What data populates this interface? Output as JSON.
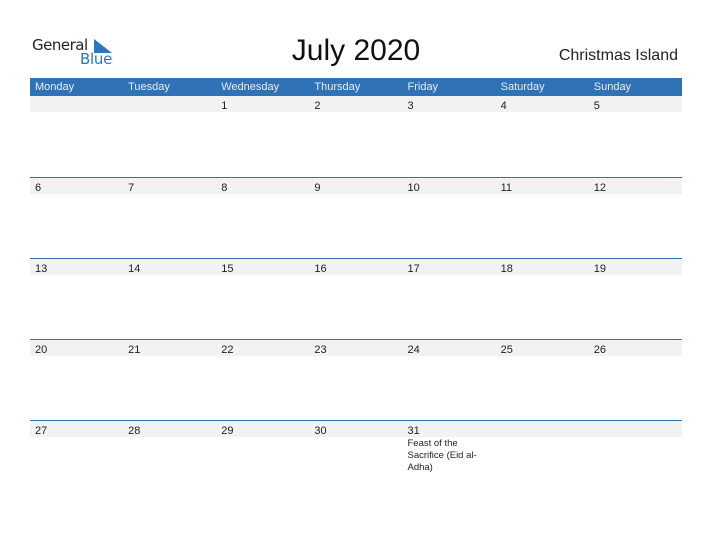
{
  "logo": {
    "general": "General",
    "blue": "Blue",
    "brand_color": "#2f75bd"
  },
  "title": "July 2020",
  "region": "Christmas Island",
  "header_color": "#2f72b5",
  "weekdays": [
    "Monday",
    "Tuesday",
    "Wednesday",
    "Thursday",
    "Friday",
    "Saturday",
    "Sunday"
  ],
  "weeks": [
    {
      "days": [
        "",
        "",
        "1",
        "2",
        "3",
        "4",
        "5"
      ],
      "events": [
        "",
        "",
        "",
        "",
        "",
        "",
        ""
      ]
    },
    {
      "days": [
        "6",
        "7",
        "8",
        "9",
        "10",
        "11",
        "12"
      ],
      "events": [
        "",
        "",
        "",
        "",
        "",
        "",
        ""
      ]
    },
    {
      "days": [
        "13",
        "14",
        "15",
        "16",
        "17",
        "18",
        "19"
      ],
      "events": [
        "",
        "",
        "",
        "",
        "",
        "",
        ""
      ]
    },
    {
      "days": [
        "20",
        "21",
        "22",
        "23",
        "24",
        "25",
        "26"
      ],
      "events": [
        "",
        "",
        "",
        "",
        "",
        "",
        ""
      ]
    },
    {
      "days": [
        "27",
        "28",
        "29",
        "30",
        "31",
        "",
        ""
      ],
      "events": [
        "",
        "",
        "",
        "",
        "Feast of the Sacrifice (Eid al-Adha)",
        "",
        ""
      ]
    }
  ]
}
